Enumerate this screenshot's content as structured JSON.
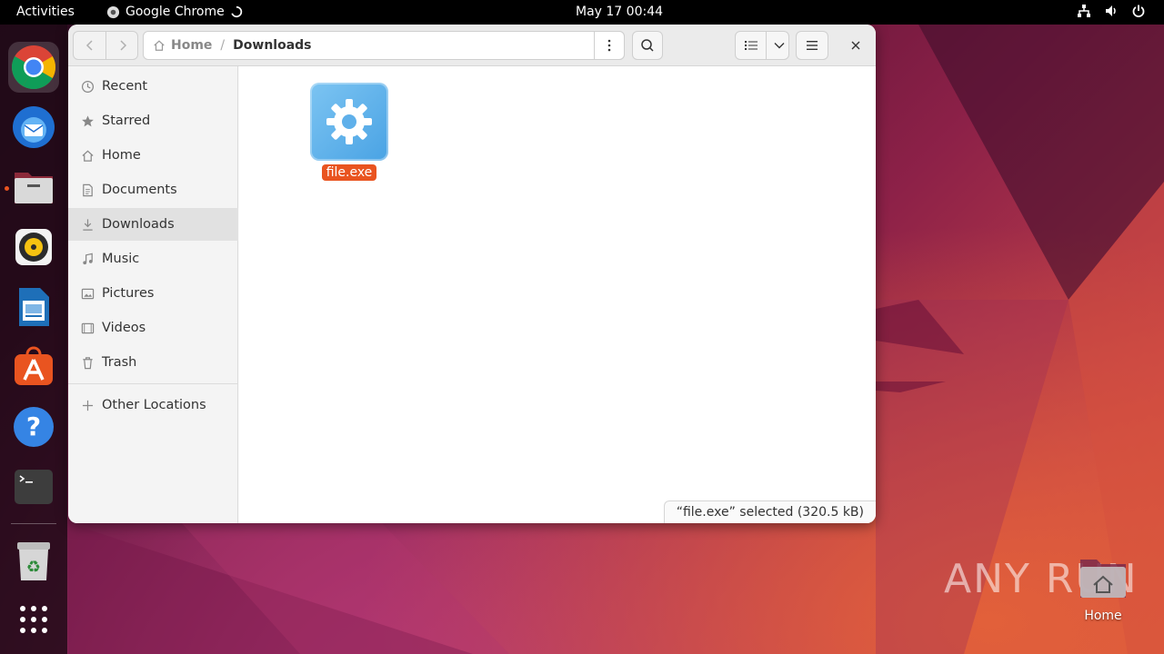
{
  "topbar": {
    "activities": "Activities",
    "app_name": "Google Chrome",
    "clock": "May 17  00:44",
    "tray_icons": [
      "network-icon",
      "volume-icon",
      "power-icon"
    ]
  },
  "dock": {
    "items": [
      {
        "name": "chrome-icon",
        "active": true
      },
      {
        "name": "thunderbird-icon"
      },
      {
        "name": "files-icon",
        "running": true
      },
      {
        "name": "rhythmbox-icon"
      },
      {
        "name": "libreoffice-writer-icon"
      },
      {
        "name": "app-center-icon"
      },
      {
        "name": "help-icon"
      },
      {
        "name": "terminal-icon"
      },
      {
        "name": "trash-icon"
      },
      {
        "name": "show-apps-icon"
      }
    ]
  },
  "window": {
    "path": {
      "home": "Home",
      "separator": "/",
      "current": "Downloads"
    },
    "sidebar": {
      "items": [
        {
          "label": "Recent",
          "icon": "clock-icon"
        },
        {
          "label": "Starred",
          "icon": "star-icon"
        },
        {
          "label": "Home",
          "icon": "home-icon"
        },
        {
          "label": "Documents",
          "icon": "document-icon"
        },
        {
          "label": "Downloads",
          "icon": "download-icon",
          "active": true
        },
        {
          "label": "Music",
          "icon": "music-icon"
        },
        {
          "label": "Pictures",
          "icon": "picture-icon"
        },
        {
          "label": "Videos",
          "icon": "video-icon"
        },
        {
          "label": "Trash",
          "icon": "trash-icon"
        }
      ],
      "other_locations": "Other Locations"
    },
    "files": [
      {
        "name": "file.exe",
        "icon": "executable-gear-icon",
        "selected": true
      }
    ],
    "status": "“file.exe” selected (320.5 kB)"
  },
  "desktop": {
    "home_label": "Home"
  },
  "watermark": "ANY RUN",
  "colors": {
    "accent": "#e95420",
    "topbar": "#000000",
    "sidebar_bg": "#f4f4f4",
    "content_bg": "#ffffff"
  }
}
